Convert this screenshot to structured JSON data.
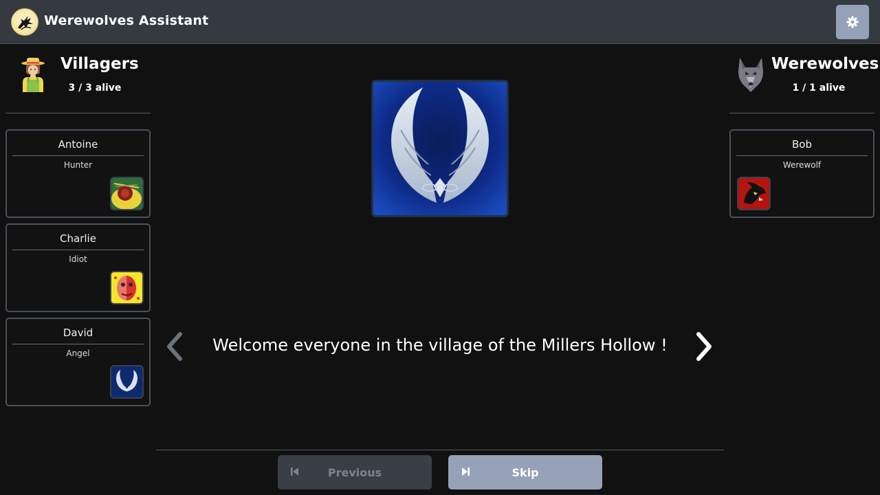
{
  "app": {
    "title": "Werewolves Assistant"
  },
  "icons": {
    "logo": "werewolf-logo-icon",
    "settings": "gear-icon",
    "villagers": "farmer-icon",
    "werewolves": "wolf-icon",
    "prev_arrow": "chevron-left-icon",
    "next_arrow": "chevron-right-icon",
    "previous": "skip-back-icon",
    "skip": "skip-forward-icon"
  },
  "villagers": {
    "name": "Villagers",
    "alive": "3 / 3 alive",
    "players": [
      {
        "name": "Antoine",
        "role": "Hunter"
      },
      {
        "name": "Charlie",
        "role": "Idiot"
      },
      {
        "name": "David",
        "role": "Angel"
      }
    ]
  },
  "werewolves": {
    "name": "Werewolves",
    "alive": "1 / 1 alive",
    "players": [
      {
        "name": "Bob",
        "role": "Werewolf"
      }
    ]
  },
  "game": {
    "message": "Welcome everyone in the village of the Millers Hollow !",
    "previous_label": "Previous",
    "skip_label": "Skip"
  },
  "colors": {
    "background": "#111111",
    "header": "#343a40",
    "accent": "#95a1b6",
    "disabled": "#3a3f46"
  }
}
